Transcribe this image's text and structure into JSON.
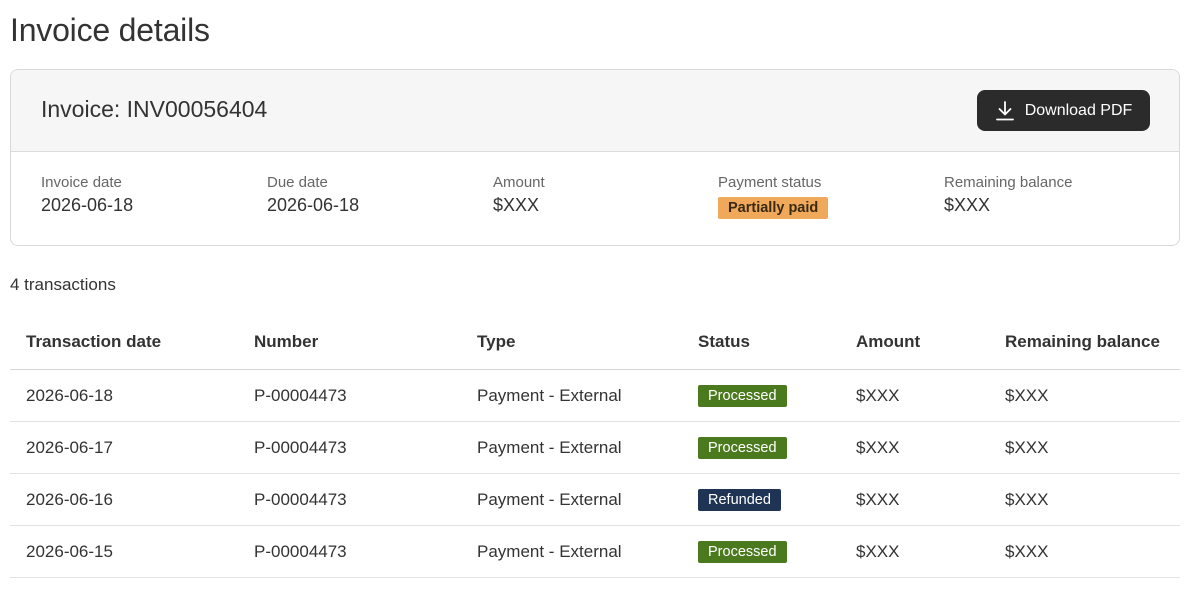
{
  "page": {
    "title": "Invoice details"
  },
  "invoice": {
    "heading": "Invoice: INV00056404",
    "download_label": "Download PDF",
    "fields": {
      "invoice_date": {
        "label": "Invoice date",
        "value": "2026-06-18"
      },
      "due_date": {
        "label": "Due date",
        "value": "2026-06-18"
      },
      "amount": {
        "label": "Amount",
        "value": "$XXX"
      },
      "payment_status": {
        "label": "Payment status",
        "value": "Partially paid",
        "color": "#f0a95a"
      },
      "remaining_balance": {
        "label": "Remaining balance",
        "value": "$XXX"
      }
    }
  },
  "transactions": {
    "count_text": "4 transactions",
    "columns": [
      "Transaction date",
      "Number",
      "Type",
      "Status",
      "Amount",
      "Remaining balance"
    ],
    "status_colors": {
      "Processed": "#4b7a1e",
      "Refunded": "#1f3354"
    },
    "rows": [
      {
        "date": "2026-06-18",
        "number": "P-00004473",
        "type": "Payment - External",
        "status": "Processed",
        "amount": "$XXX",
        "remaining": "$XXX"
      },
      {
        "date": "2026-06-17",
        "number": "P-00004473",
        "type": "Payment - External",
        "status": "Processed",
        "amount": "$XXX",
        "remaining": "$XXX"
      },
      {
        "date": "2026-06-16",
        "number": "P-00004473",
        "type": "Payment - External",
        "status": "Refunded",
        "amount": "$XXX",
        "remaining": "$XXX"
      },
      {
        "date": "2026-06-15",
        "number": "P-00004473",
        "type": "Payment - External",
        "status": "Processed",
        "amount": "$XXX",
        "remaining": "$XXX"
      }
    ]
  }
}
